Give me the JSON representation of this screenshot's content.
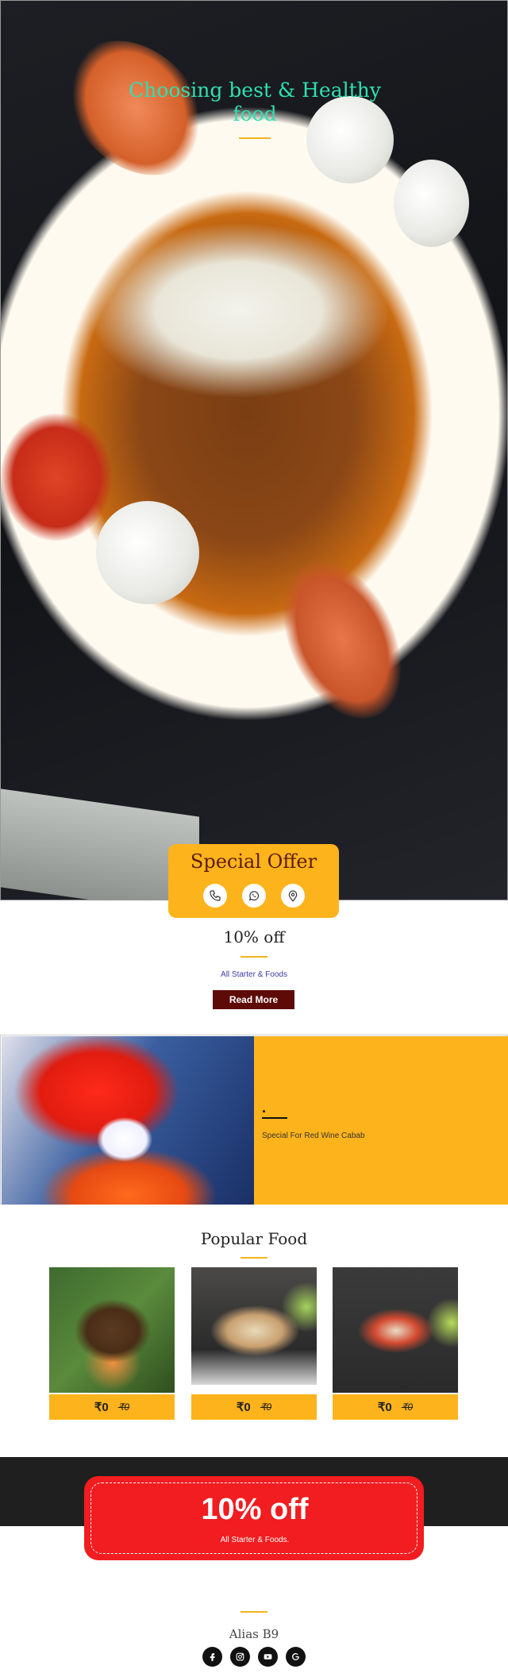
{
  "hero": {
    "title": "Choosing best & Healthy food"
  },
  "offer_card": {
    "title": "Special Offer",
    "icons": [
      "phone-icon",
      "whatsapp-icon",
      "location-pin-icon"
    ]
  },
  "deal": {
    "title": "10% off",
    "subtitle": "All Starter & Foods",
    "button_label": "Read More"
  },
  "split_banner": {
    "heading": ".",
    "text": "Special For Red Wine Cabab"
  },
  "popular": {
    "title": "Popular Food",
    "items": [
      {
        "price": "₹0",
        "old_price": "₹0"
      },
      {
        "price": "₹0",
        "old_price": "₹0"
      },
      {
        "price": "₹0",
        "old_price": "₹0"
      }
    ]
  },
  "promo": {
    "headline": "10% off",
    "subtext": "All Starter & Foods."
  },
  "footer": {
    "name": "Alias B9",
    "social": [
      "facebook-icon",
      "instagram-icon",
      "youtube-icon",
      "google-icon"
    ]
  },
  "colors": {
    "accent": "#fdb31c",
    "dark_red": "#5e0b08",
    "promo_red": "#f11d20",
    "hero_title": "#2fe0b0"
  }
}
